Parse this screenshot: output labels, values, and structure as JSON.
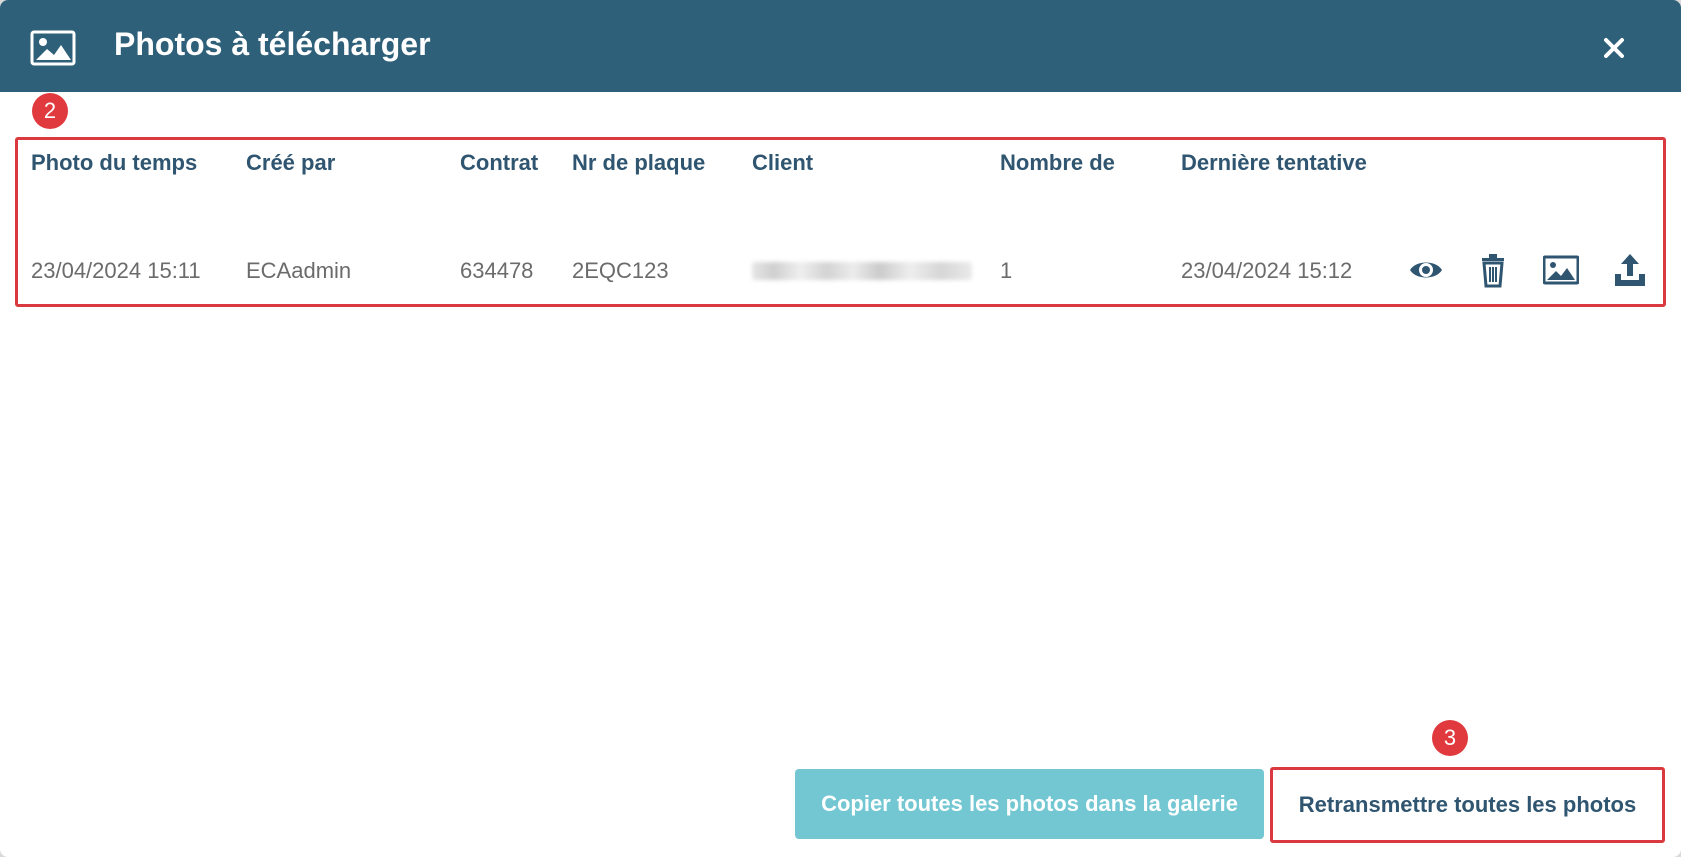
{
  "dialog": {
    "title": "Photos à télécharger",
    "title_icon": "image-icon",
    "close_icon": "close-icon"
  },
  "annotations": {
    "badge_table": "2",
    "badge_button": "3"
  },
  "table": {
    "columns": [
      "Photo du temps",
      "Créé par",
      "Contrat",
      "Nr de plaque",
      "Client",
      "Nombre de",
      "Dernière tentative"
    ],
    "rows": [
      {
        "photo_time": "23/04/2024 15:11",
        "created_by": "ECAadmin",
        "contract": "634478",
        "plate": "2EQC123",
        "client": "",
        "count": "1",
        "last_attempt": "23/04/2024 15:12",
        "actions": [
          "eye-icon",
          "trash-icon",
          "image-icon",
          "upload-icon"
        ]
      }
    ]
  },
  "footer": {
    "copy_label": "Copier toutes les photos dans la galerie",
    "retransmit_label": "Retransmettre toutes les photos"
  },
  "colors": {
    "header_bg": "#2f6079",
    "accent_text": "#2f5570",
    "copy_button_bg": "#72c7d3",
    "highlight": "#d9393f",
    "badge": "#e03a3e"
  }
}
